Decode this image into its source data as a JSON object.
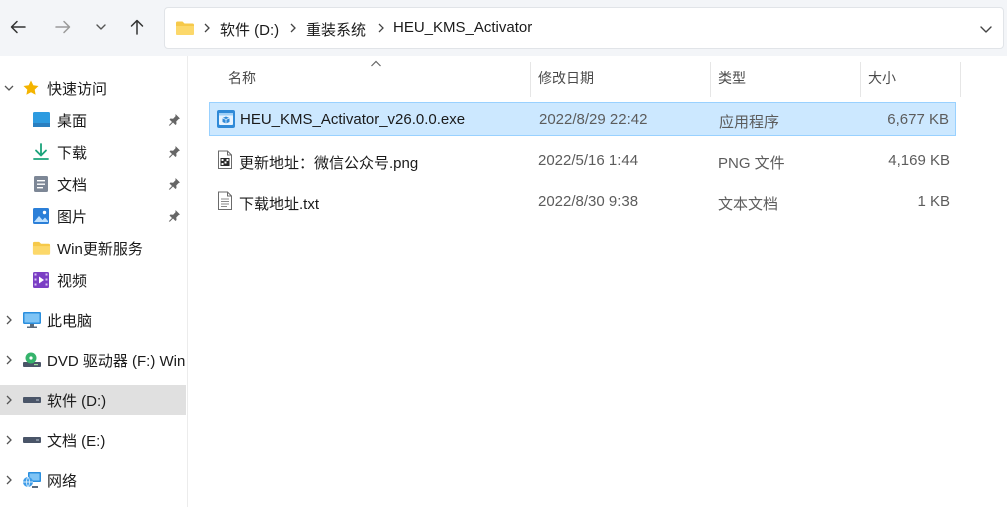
{
  "toolbar": {
    "back_icon": "arrow-left-icon",
    "forward_icon": "arrow-right-icon",
    "recent_icon": "chevron-down-icon",
    "up_icon": "arrow-up-icon"
  },
  "address": {
    "crumbs": [
      "软件 (D:)",
      "重装系统",
      "HEU_KMS_Activator"
    ]
  },
  "sidebar": {
    "items": [
      {
        "label": "快速访问",
        "icon": "star-icon"
      },
      {
        "label": "桌面",
        "icon": "desktop-icon"
      },
      {
        "label": "下载",
        "icon": "download-icon"
      },
      {
        "label": "文档",
        "icon": "document-icon"
      },
      {
        "label": "图片",
        "icon": "pictures-icon"
      },
      {
        "label": "Win更新服务",
        "icon": "folder-icon"
      },
      {
        "label": "视频",
        "icon": "video-icon"
      },
      {
        "label": "此电脑",
        "icon": "computer-icon"
      },
      {
        "label": "DVD 驱动器 (F:) Win",
        "icon": "dvd-drive-icon"
      },
      {
        "label": "软件 (D:)",
        "icon": "drive-icon"
      },
      {
        "label": "文档 (E:)",
        "icon": "drive-icon"
      },
      {
        "label": "网络",
        "icon": "network-icon"
      }
    ]
  },
  "columns": {
    "name": "名称",
    "date": "修改日期",
    "type": "类型",
    "size": "大小"
  },
  "files": [
    {
      "name": "HEU_KMS_Activator_v26.0.0.exe",
      "date": "2022/8/29 22:42",
      "type": "应用程序",
      "size": "6,677 KB",
      "icon": "exe-icon"
    },
    {
      "name": "更新地址：微信公众号.png",
      "date": "2022/5/16 1:44",
      "type": "PNG 文件",
      "size": "4,169 KB",
      "icon": "image-file-icon"
    },
    {
      "name": "下载地址.txt",
      "date": "2022/8/30 9:38",
      "type": "文本文档",
      "size": "1 KB",
      "icon": "text-file-icon"
    }
  ],
  "colors": {
    "selected_row": "#cce8ff",
    "selected_row_border": "#99d1ff",
    "selected_nav": "#e0e0e0",
    "topbar": "#f3f5f8",
    "folder": "#f6c94a"
  }
}
